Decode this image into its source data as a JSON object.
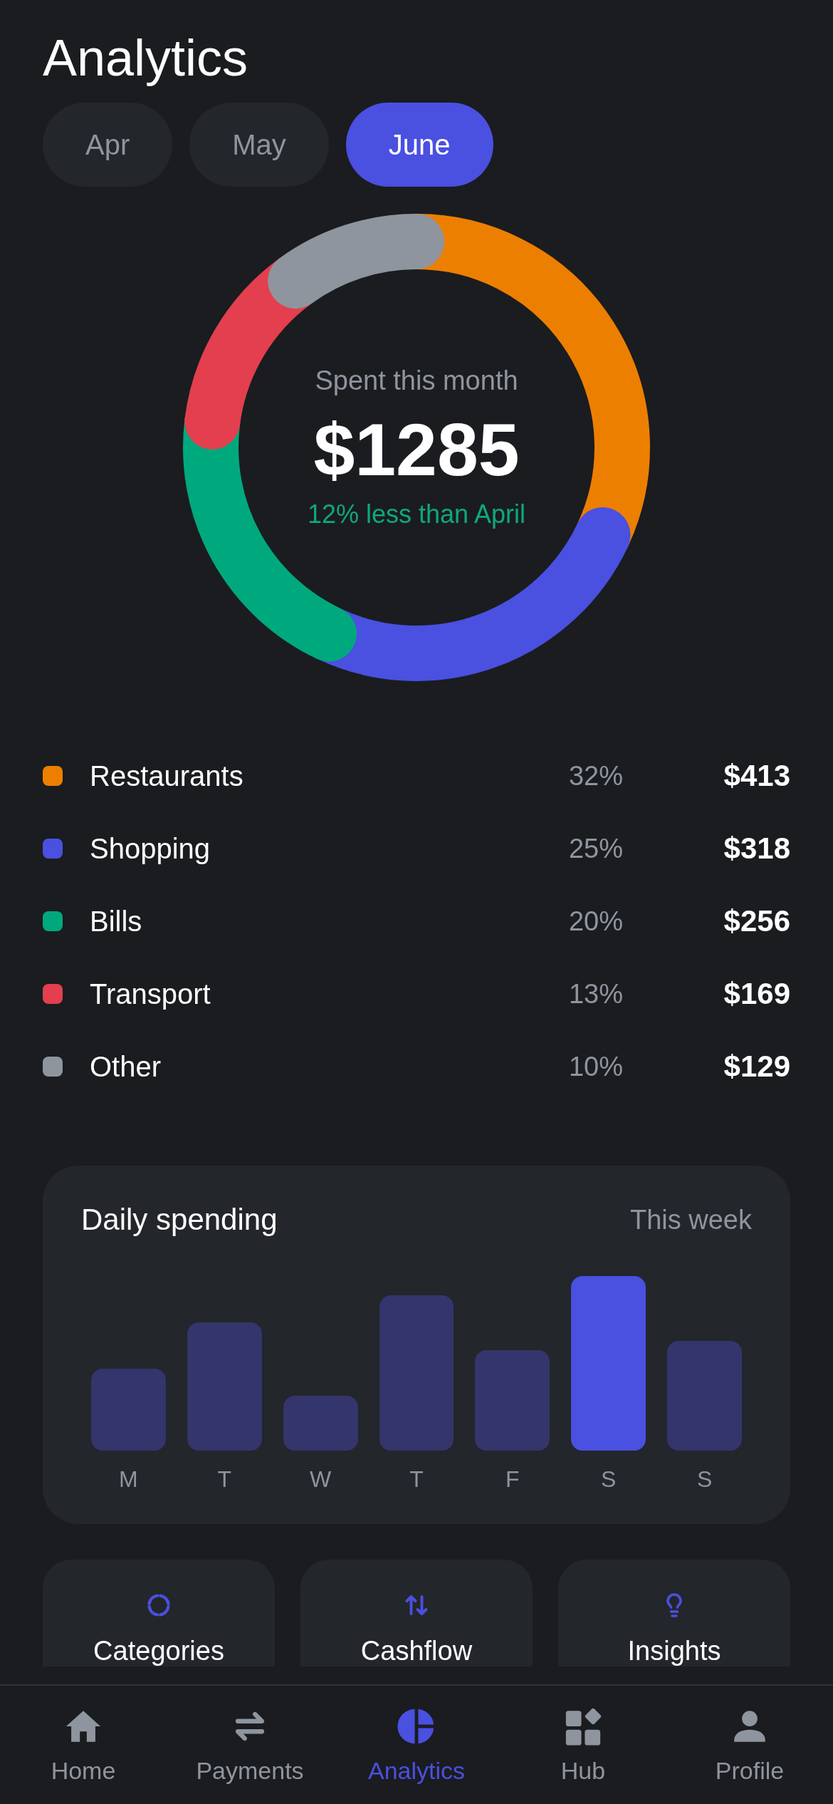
{
  "title": "Analytics",
  "months": [
    {
      "label": "Apr",
      "selected": false
    },
    {
      "label": "May",
      "selected": false
    },
    {
      "label": "June",
      "selected": true
    }
  ],
  "summary": {
    "caption": "Spent this month",
    "amount": "$1285",
    "comparison": "12% less than April"
  },
  "categories": [
    {
      "name": "Restaurants",
      "percent": "32%",
      "amount": "$413",
      "color": "#ed7f00"
    },
    {
      "name": "Shopping",
      "percent": "25%",
      "amount": "$318",
      "color": "#4a50e0"
    },
    {
      "name": "Bills",
      "percent": "20%",
      "amount": "$256",
      "color": "#00a97d"
    },
    {
      "name": "Transport",
      "percent": "13%",
      "amount": "$169",
      "color": "#e33f4e"
    },
    {
      "name": "Other",
      "percent": "10%",
      "amount": "$129",
      "color": "#8e959e"
    }
  ],
  "daily": {
    "title": "Daily spending",
    "period": "This week",
    "bars": [
      {
        "label": "M",
        "selected": false
      },
      {
        "label": "T",
        "selected": false
      },
      {
        "label": "W",
        "selected": false
      },
      {
        "label": "T",
        "selected": false
      },
      {
        "label": "F",
        "selected": false
      },
      {
        "label": "S",
        "selected": true
      },
      {
        "label": "S",
        "selected": false
      }
    ]
  },
  "tiles": [
    {
      "kind": "ring",
      "label": "Categories"
    },
    {
      "kind": "updown",
      "label": "Cashflow"
    },
    {
      "kind": "bulb",
      "label": "Insights"
    }
  ],
  "nav": [
    {
      "kind": "home",
      "label": "Home",
      "selected": false
    },
    {
      "kind": "swap",
      "label": "Payments",
      "selected": false
    },
    {
      "kind": "pie",
      "label": "Analytics",
      "selected": true
    },
    {
      "kind": "grid",
      "label": "Hub",
      "selected": false
    },
    {
      "kind": "user",
      "label": "Profile",
      "selected": false
    }
  ]
}
